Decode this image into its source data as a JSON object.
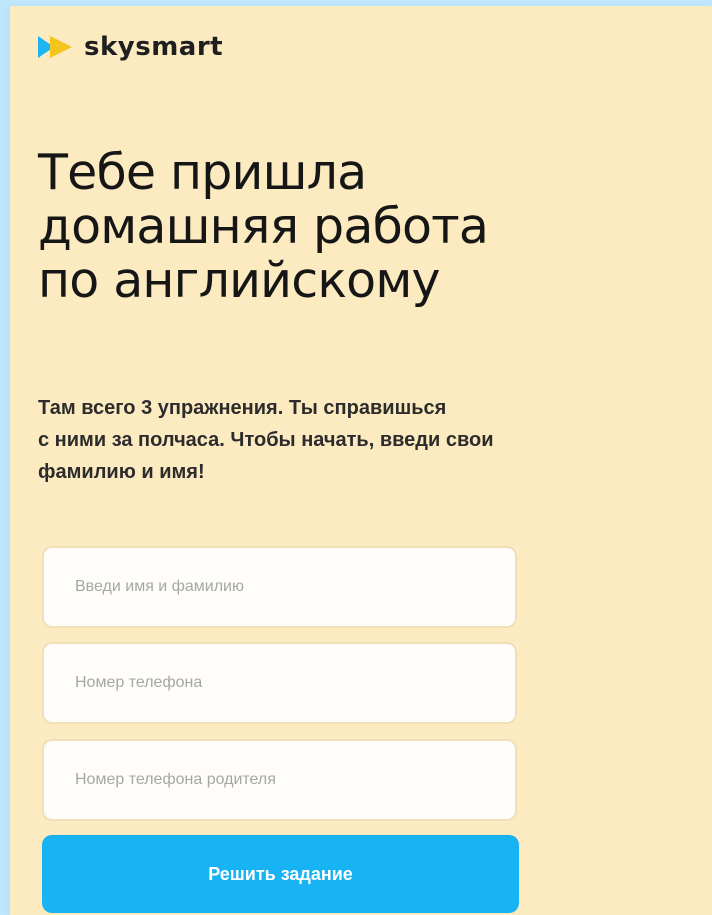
{
  "brand": {
    "name": "skysmart",
    "logo_icon": "play-arrow-icon",
    "colors": {
      "logo_blue": "#1fb5f2",
      "logo_yellow": "#f3c51d"
    }
  },
  "hero": {
    "title_lines": [
      "Тебе пришла",
      "домашняя работа",
      "по английскому"
    ],
    "description_lines": [
      "Там всего 3 упражнения. Ты справишься",
      "с ними за полчаса. Чтобы начать, введи свои",
      "фамилию и имя!"
    ]
  },
  "form": {
    "name_field": {
      "value": "",
      "placeholder": "Введи имя и фамилию"
    },
    "phone_field": {
      "value": "",
      "placeholder": "Номер телефона"
    },
    "parent_phone_field": {
      "value": "",
      "placeholder": "Номер телефона родителя"
    },
    "submit_label": "Решить задание"
  },
  "theme": {
    "background": "#fcebc0",
    "accent": "#18b3f3"
  }
}
